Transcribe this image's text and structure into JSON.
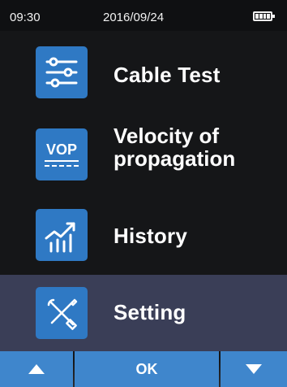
{
  "status_bar": {
    "time": "09:30",
    "date": "2016/09/24",
    "battery_icon": "battery-full-icon"
  },
  "menu": {
    "items": [
      {
        "label": "Cable Test",
        "icon": "sliders-icon"
      },
      {
        "label_line1": "Velocity of",
        "label_line2": "propagation",
        "icon_text": "VOP",
        "icon": "vop-icon"
      },
      {
        "label": "History",
        "icon": "growth-chart-icon"
      },
      {
        "label": "Setting",
        "icon": "tools-icon",
        "selected": true
      }
    ]
  },
  "nav": {
    "up_icon": "triangle-up-icon",
    "ok_label": "OK",
    "down_icon": "triangle-down-icon"
  },
  "colors": {
    "background": "#151618",
    "accent": "#2f79c4",
    "button": "#3f86cc",
    "selected_row": "#3a3e57"
  }
}
